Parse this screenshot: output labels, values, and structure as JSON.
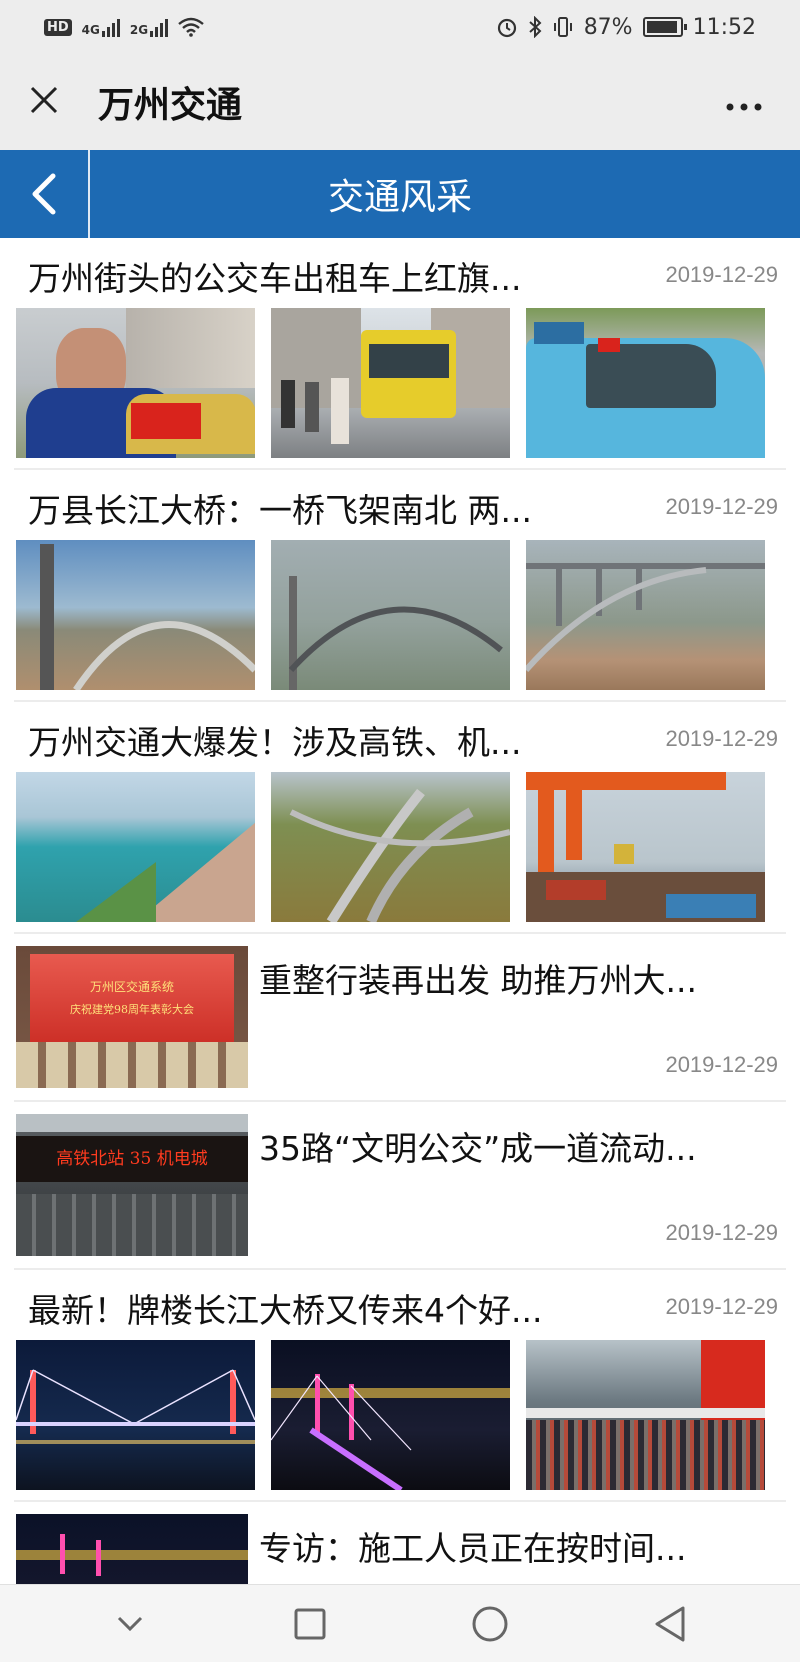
{
  "status_bar": {
    "hd": "HD",
    "network_1": "4G",
    "network_2": "2G",
    "battery": "87%",
    "time": "11:52"
  },
  "title_bar": {
    "close_icon": "close-icon",
    "title": "万州交通",
    "more": "···"
  },
  "header": {
    "section_title": "交通风采"
  },
  "articles": [
    {
      "title": "万州街头的公交车出租车上红旗...",
      "date": "2019-12-29"
    },
    {
      "title": "万县长江大桥：一桥飞架南北 两...",
      "date": "2019-12-29"
    },
    {
      "title": "万州交通大爆发！涉及高铁、机...",
      "date": "2019-12-29"
    },
    {
      "title": "重整行装再出发 助推万州大...",
      "date": "2019-12-29"
    },
    {
      "title": "35路“文明公交”成一道流动...",
      "date": "2019-12-29"
    },
    {
      "title": "最新！牌楼长江大桥又传来4个好...",
      "date": "2019-12-29"
    },
    {
      "title": "专访：施工人员正在按时间...",
      "date": ""
    }
  ],
  "thumb_text": {
    "bus_sign": "高铁北站 35 机电城",
    "stage_banner_1": "万州区交通系统",
    "stage_banner_2": "庆祝建党98周年表彰大会"
  },
  "colors": {
    "header_blue": "#1d6ab3",
    "date_gray": "#888888"
  }
}
